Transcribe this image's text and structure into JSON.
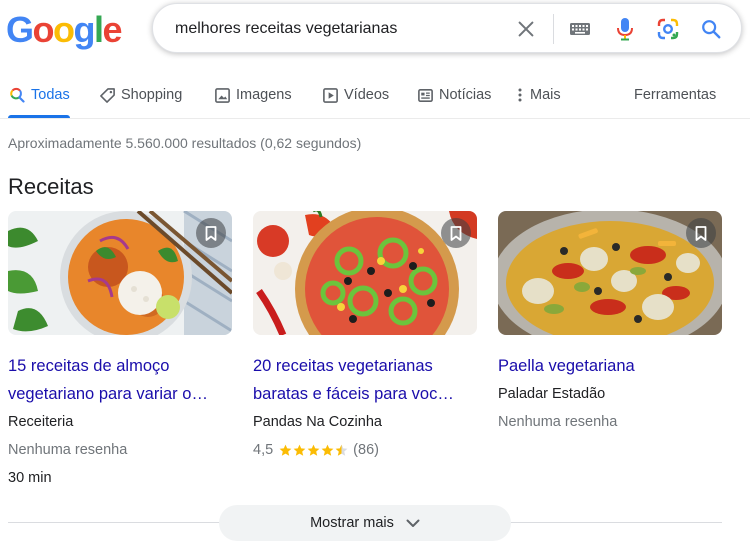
{
  "logo": {
    "text": "Google",
    "colors": [
      "#4285F4",
      "#EA4335",
      "#FBBC05",
      "#4285F4",
      "#34A853",
      "#EA4335"
    ]
  },
  "search": {
    "query": "melhores receitas vegetarianas"
  },
  "tabs": [
    {
      "label": "Todas",
      "icon": "search-icon",
      "active": true
    },
    {
      "label": "Shopping",
      "icon": "tag-icon"
    },
    {
      "label": "Imagens",
      "icon": "image-icon"
    },
    {
      "label": "Vídeos",
      "icon": "play-icon"
    },
    {
      "label": "Notícias",
      "icon": "news-icon"
    },
    {
      "label": "Mais",
      "icon": "more-vert-icon"
    }
  ],
  "tools_label": "Ferramentas",
  "result_stats": "Aproximadamente 5.560.000 resultados (0,62 segundos)",
  "recipes": {
    "title": "Receitas",
    "cards": [
      {
        "title_line1": "15 receitas de almoço",
        "title_line2": "vegetariano para variar o…",
        "source": "Receiteria",
        "review": "Nenhuma resenha",
        "time": "30 min"
      },
      {
        "title_line1": "20 receitas vegetarianas",
        "title_line2": "baratas e fáceis para voc…",
        "source": "Pandas Na Cozinha",
        "rating_value": "4,5",
        "rating_stars": 4.5,
        "rating_count": "(86)"
      },
      {
        "title_line1": "Paella vegetariana",
        "source": "Paladar Estadão",
        "review": "Nenhuma resenha"
      }
    ],
    "show_more": "Mostrar mais"
  },
  "colors": {
    "accent": "#1a73e8",
    "link": "#1a0dab",
    "star": "#fbbc04"
  }
}
